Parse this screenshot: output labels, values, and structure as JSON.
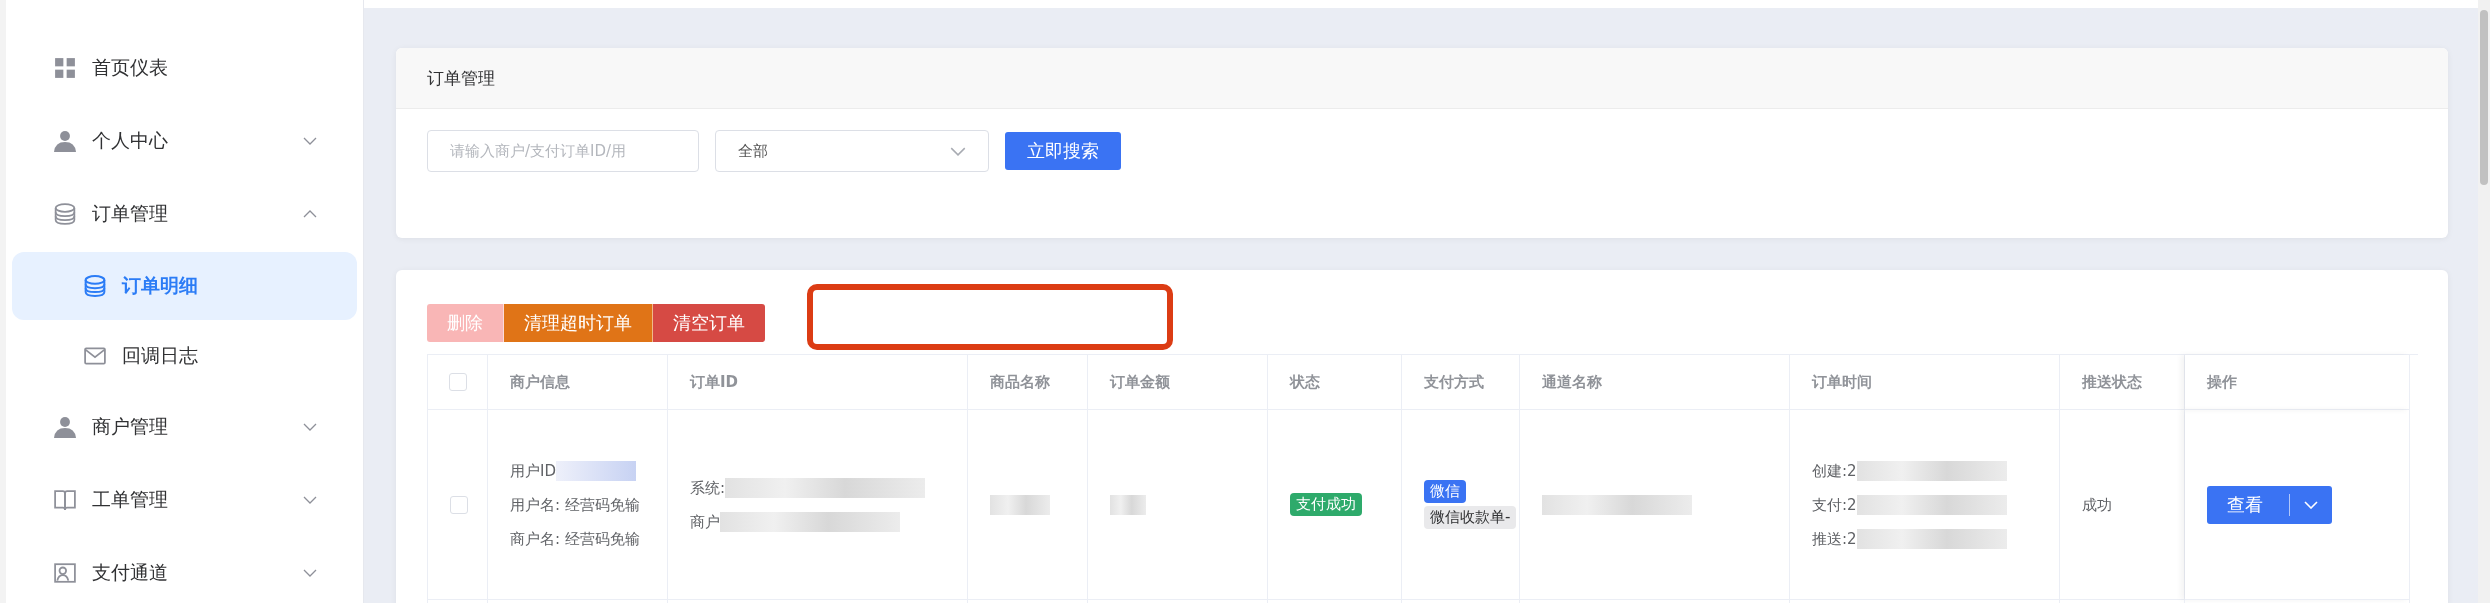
{
  "sidebar": {
    "items": [
      {
        "label": "首页仪表",
        "selected": false
      },
      {
        "label": "个人中心",
        "selected": false,
        "expanded": false
      },
      {
        "label": "订单管理",
        "selected": false,
        "expanded": true,
        "children": [
          {
            "label": "订单明细",
            "selected": true
          },
          {
            "label": "回调日志",
            "selected": false
          }
        ]
      },
      {
        "label": "商户管理",
        "selected": false,
        "expanded": false
      },
      {
        "label": "工单管理",
        "selected": false,
        "expanded": false
      },
      {
        "label": "支付通道",
        "selected": false,
        "expanded": false
      }
    ]
  },
  "search_card": {
    "title": "订单管理",
    "search_field": {
      "placeholder": "请输入商户/支付订单ID/用"
    },
    "status_select": {
      "value": "全部"
    },
    "search_button": "立即搜索"
  },
  "table_card": {
    "actions": [
      {
        "label": "删除",
        "kind": "delete",
        "disabled": true
      },
      {
        "label": "清理超时订单",
        "kind": "warning",
        "disabled": false
      },
      {
        "label": "清空订单",
        "kind": "danger",
        "disabled": false
      }
    ],
    "table": {
      "header_checked": false,
      "columns": [
        "商户信息",
        "订单ID",
        "商品名称",
        "订单金额",
        "状态",
        "支付方式",
        "通道名称",
        "订单时间",
        "推送状态",
        "操作"
      ],
      "rows": [
        {
          "checked": false,
          "merchant_info": [
            "用户ID",
            "用户名: 经营码免输",
            "商户名: 经营码免输"
          ],
          "order_id": [
            "系统:",
            "商户"
          ],
          "status": "支付成功",
          "pay_method": {
            "tag": "微信",
            "channel": "微信收款单-"
          },
          "order_time": [
            "创建:2",
            "支付:2",
            "推送:2"
          ],
          "push_status": "成功",
          "action": "查看"
        }
      ]
    }
  }
}
